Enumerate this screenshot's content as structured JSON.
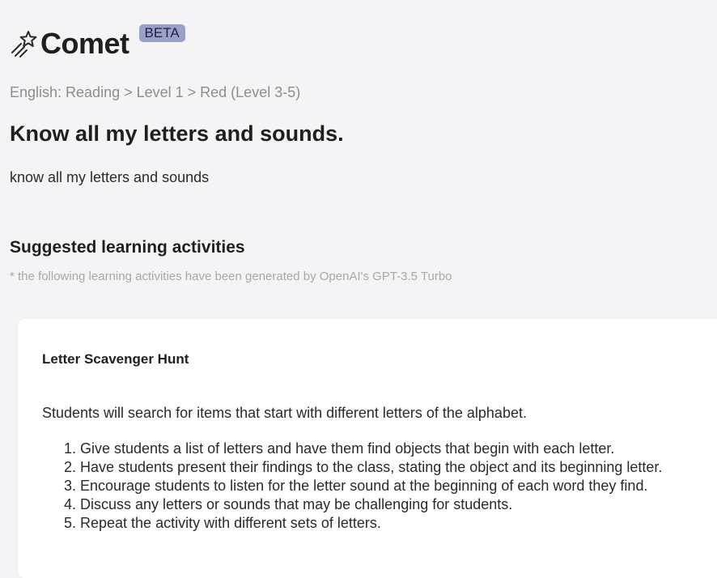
{
  "app": {
    "name": "Comet",
    "badge": "BETA"
  },
  "breadcrumb": "English: Reading > Level 1 > Red (Level 3-5)",
  "goal": {
    "title": "Know all my letters and sounds.",
    "description": "know all my letters and sounds"
  },
  "activities_section": {
    "title": "Suggested learning activities",
    "disclaimer": "* the following learning activities have been generated by OpenAI's GPT-3.5 Turbo"
  },
  "activities": [
    {
      "title": "Letter Scavenger Hunt",
      "summary": "Students will search for items that start with different letters of the alphabet.",
      "steps": [
        "Give students a list of letters and have them find objects that begin with each letter.",
        "Have students present their findings to the class, stating the object and its beginning letter.",
        "Encourage students to listen for the letter sound at the beginning of each word they find.",
        "Discuss any letters or sounds that may be challenging for students.",
        "Repeat the activity with different sets of letters."
      ]
    }
  ],
  "icons": {
    "logo": "shooting-star-icon"
  },
  "colors": {
    "background": "#f4f4f6",
    "badge_bg": "#9aa0c8",
    "muted_text": "#8d8d8d"
  }
}
